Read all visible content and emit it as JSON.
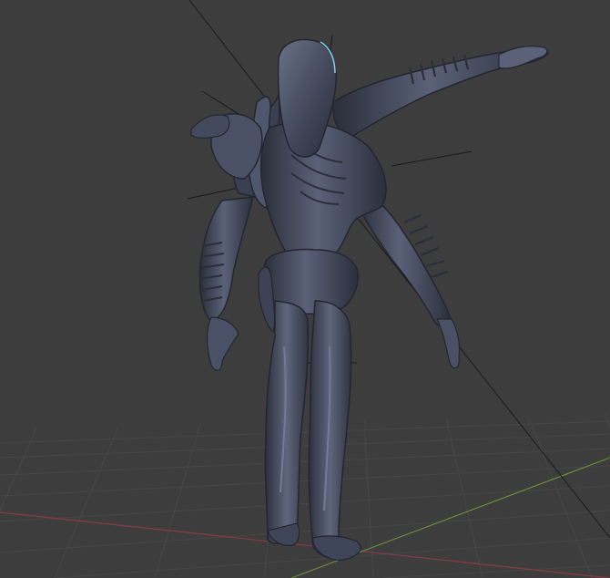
{
  "viewport": {
    "background": "#3d3d3d",
    "grid_color": "#474747",
    "axis_x_color": "#8a3b44",
    "axis_y_color": "#6d8a3a",
    "model_color": "#4a5167",
    "model_highlight": "#737c96",
    "model_shadow": "#23262f",
    "rig_line_color": "#1a1a1a",
    "accent_glow": "#7fd6ee"
  }
}
